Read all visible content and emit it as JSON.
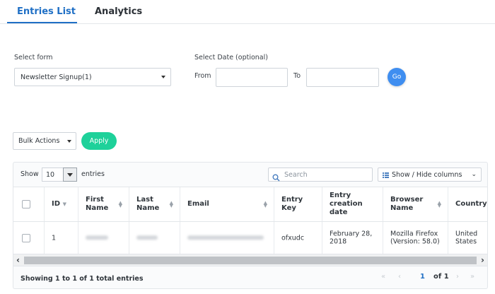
{
  "tabs": {
    "entries": "Entries List",
    "analytics": "Analytics"
  },
  "filters": {
    "select_form_label": "Select form",
    "select_form_value": "Newsletter Signup(1)",
    "date_label": "Select Date (optional)",
    "from_label": "From",
    "to_label": "To",
    "go_label": "Go"
  },
  "bulk": {
    "select_value": "Bulk Actions",
    "apply_label": "Apply"
  },
  "table_controls": {
    "show_label": "Show",
    "show_value": "10",
    "entries_label": "entries",
    "search_placeholder": "Search",
    "columns_label": "Show / Hide columns"
  },
  "table": {
    "headers": {
      "id": "ID",
      "first_name": "First Name",
      "last_name": "Last Name",
      "email": "Email",
      "entry_key": "Entry Key",
      "entry_creation_date": "Entry creation date",
      "browser_name": "Browser Name",
      "country": "Country"
    },
    "rows": [
      {
        "id": "1",
        "entry_key": "ofxudc",
        "entry_creation_date": "February 28, 2018",
        "browser_name": "Mozilla Firefox (Version: 58.0)",
        "country": "United States"
      }
    ]
  },
  "footer": {
    "summary": "Showing 1 to 1 of 1 total entries",
    "current_page": "1",
    "of_pages": "of 1"
  },
  "colors": {
    "accent": "#1f6fc5",
    "go_button": "#3f8ef0",
    "apply_button": "#1ed19a"
  }
}
